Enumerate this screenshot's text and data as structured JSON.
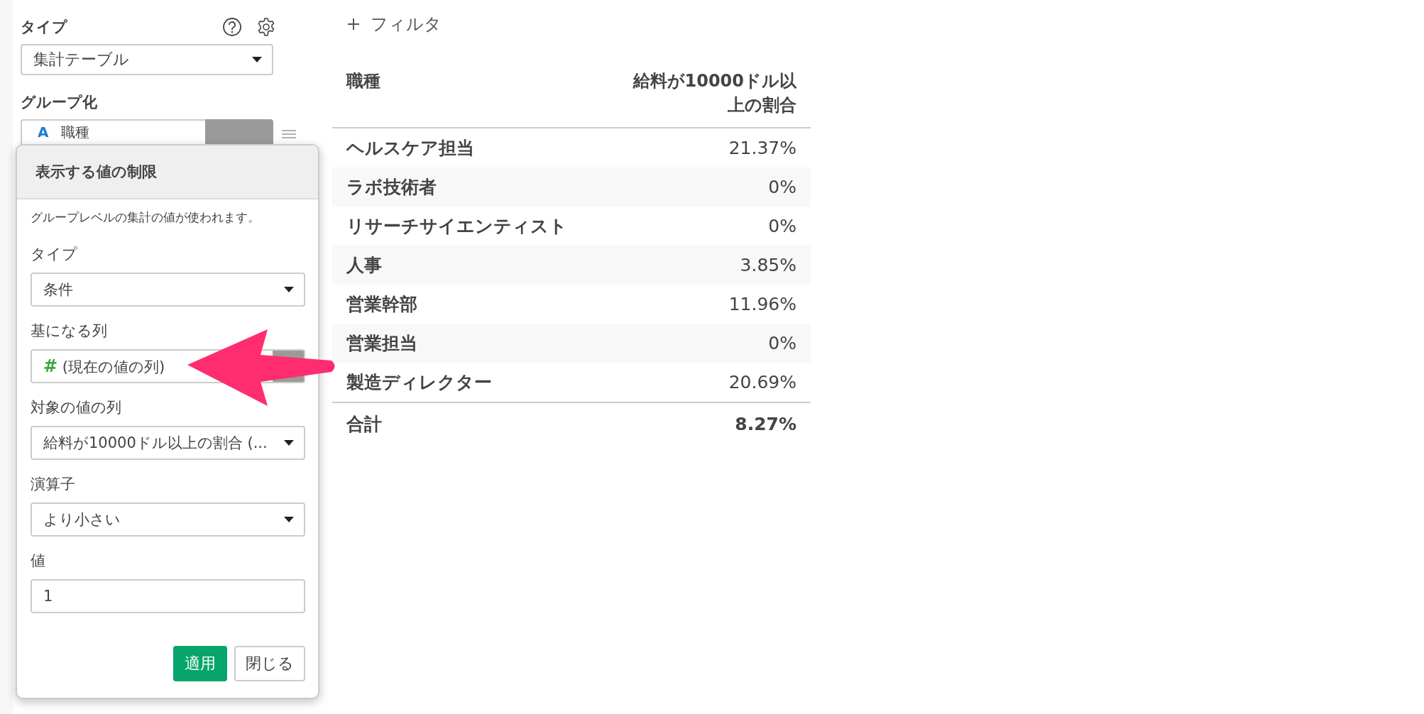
{
  "sidebar": {
    "type_label": "タイプ",
    "type_select": "集計テーブル",
    "grouping_label": "グループ化",
    "group_item_mark": "A",
    "group_item": "職種"
  },
  "popup": {
    "title": "表示する値の制限",
    "description": "グループレベルの集計の値が使われます。",
    "fields": [
      {
        "label": "タイプ",
        "kind": "select",
        "value": "条件"
      },
      {
        "label": "基になる列",
        "kind": "column",
        "type_mark": "#",
        "value": "(現在の値の列)"
      },
      {
        "label": "対象の値の列",
        "kind": "select",
        "value": "給料が10000ドル以上の割合 (..."
      },
      {
        "label": "演算子",
        "kind": "select",
        "value": "より小さい"
      },
      {
        "label": "値",
        "kind": "input",
        "value": "1"
      }
    ],
    "buttons": [
      {
        "label": "適用",
        "kind": "primary"
      },
      {
        "label": "閉じる",
        "kind": "secondary"
      }
    ]
  },
  "filter": {
    "label": "フィルタ"
  },
  "table": {
    "columns": [
      "職種",
      "給料が10000ドル以上の割合"
    ],
    "rows": [
      [
        "ヘルスケア担当",
        "21.37%"
      ],
      [
        "ラボ技術者",
        "0%"
      ],
      [
        "リサーチサイエンティスト",
        "0%"
      ],
      [
        "人事",
        "3.85%"
      ],
      [
        "営業幹部",
        "11.96%"
      ],
      [
        "営業担当",
        "0%"
      ],
      [
        "製造ディレクター",
        "20.69%"
      ]
    ],
    "total": [
      "合計",
      "8.27%"
    ]
  }
}
